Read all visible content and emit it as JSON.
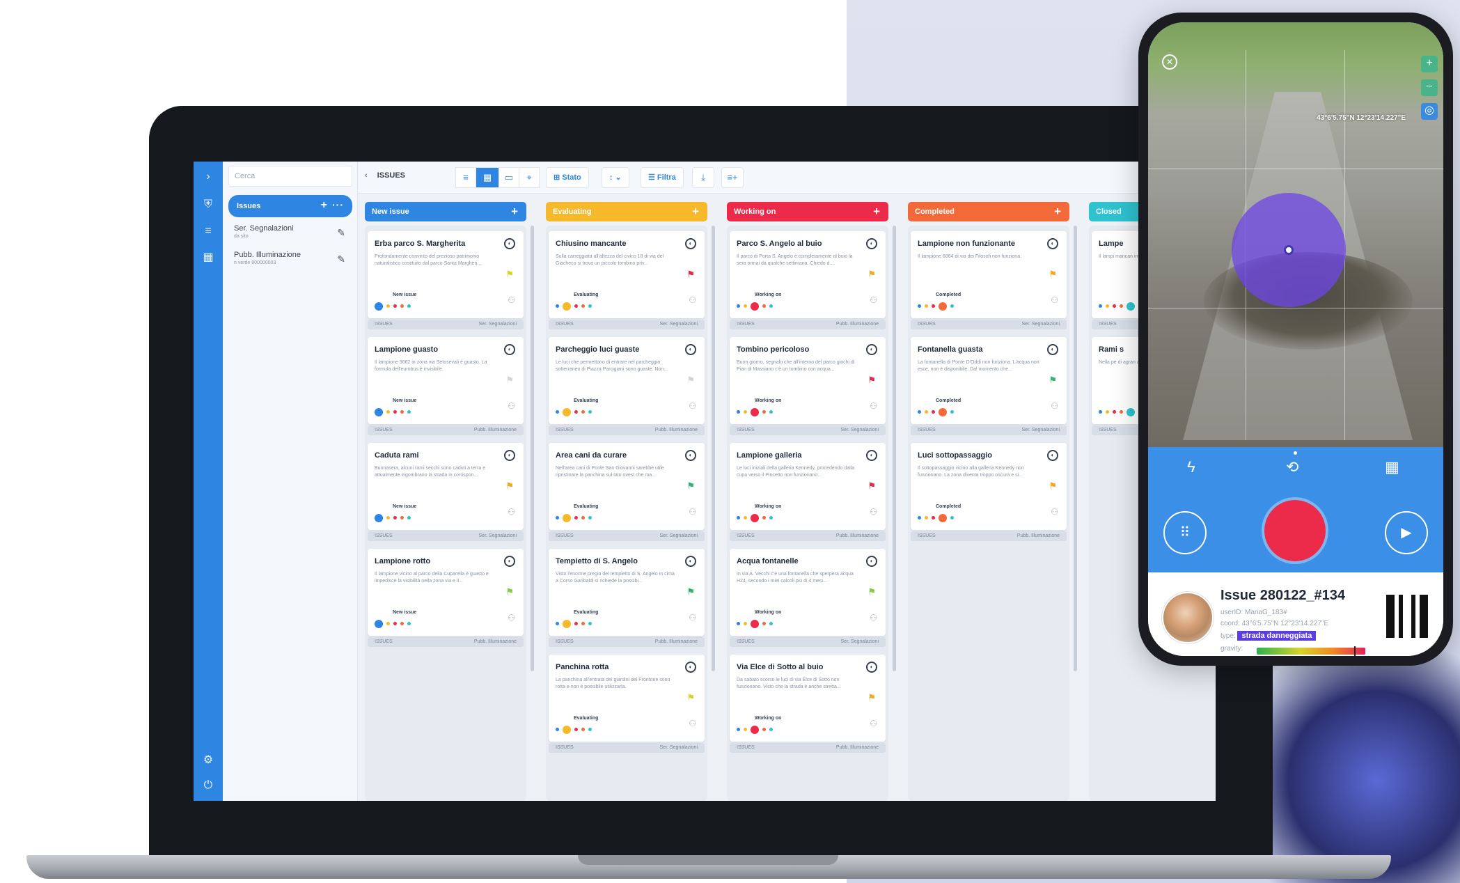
{
  "app": {
    "search_placeholder": "Cerca",
    "issues_label": "Issues",
    "sidebar_items": [
      {
        "label": "Ser. Segnalazioni",
        "sub": "da sito"
      },
      {
        "label": "Pubb. Illuminazione",
        "sub": "n verde 800000003"
      }
    ],
    "breadcrumb": "ISSUES",
    "toolbar": {
      "stato_label": "Stato",
      "filtra_label": "Filtra"
    }
  },
  "columns": [
    {
      "title": "New issue",
      "color": "#2f86e2",
      "status_color": "#2f86e2",
      "cards": [
        {
          "title": "Erba parco S. Margherita",
          "desc": "Profondamente convinto del prezioso patrimonio naturalistico costituito dal parco Santa Margheri...",
          "status": "New issue",
          "flag": "#d6d42a",
          "foot_l": "ISSUES",
          "foot_r": "Ser. Segnalazioni"
        },
        {
          "title": "Lampione guasto",
          "desc": "Il lampione 3662 in zona via Setosevali è guasto. La formula dell'eurobus è invisibile.",
          "status": "New issue",
          "flag": "#d0d5dc",
          "foot_l": "ISSUES",
          "foot_r": "Pubb. Illuminazione"
        },
        {
          "title": "Caduta rami",
          "desc": "Buonasera, alcuni rami secchi sono caduti a terra e attualmente ingombrano la strada in corrispon...",
          "status": "New issue",
          "flag": "#f3a623",
          "foot_l": "ISSUES",
          "foot_r": "Ser. Segnalazioni"
        },
        {
          "title": "Lampione rotto",
          "desc": "Il lampione vicino al parco della Cuparella è guasto e impedisce la visibilità nella zona via e il...",
          "status": "New issue",
          "flag": "#7fce3e",
          "foot_l": "ISSUES",
          "foot_r": "Pubb. Illuminazione"
        }
      ]
    },
    {
      "title": "Evaluating",
      "color": "#f5b92b",
      "status_color": "#f5b92b",
      "cards": [
        {
          "title": "Chiusino mancante",
          "desc": "Sulla carreggiata all'altezza del civico 18 di via del Giacheco si trova un piccolo tombino priv...",
          "status": "Evaluating",
          "flag": "#e8294a",
          "foot_l": "ISSUES",
          "foot_r": "Ser. Segnalazioni"
        },
        {
          "title": "Parcheggio luci guaste",
          "desc": "Le luci che permettono di entrare nel parcheggio sotterraneo di Piazza Parcigiani sono guaste. Non...",
          "status": "Evaluating",
          "flag": "#d0d5dc",
          "foot_l": "ISSUES",
          "foot_r": "Pubb. Illuminazione"
        },
        {
          "title": "Area cani da curare",
          "desc": "Nell'area cani di Ponte San Giovanni sarebbe utile ripristinare la panchina sul lato ovest che ma...",
          "status": "Evaluating",
          "flag": "#2fb56a",
          "foot_l": "ISSUES",
          "foot_r": "Ser. Segnalazioni"
        },
        {
          "title": "Tempietto di S. Angelo",
          "desc": "Visto l'enorme pregio del tempietto di S. Angelo in cima a Corso Garibaldi si richiede la possibi...",
          "status": "Evaluating",
          "flag": "#2fb56a",
          "foot_l": "ISSUES",
          "foot_r": "Pubb. Illuminazione"
        },
        {
          "title": "Panchina rotta",
          "desc": "La panchina all'entrata dei giardini del Frontone sono rotta e non è possibile utilizzarla.",
          "status": "Evaluating",
          "flag": "#d6d42a",
          "foot_l": "ISSUES",
          "foot_r": "Ser. Segnalazioni"
        }
      ]
    },
    {
      "title": "Working on",
      "color": "#ec2a4a",
      "status_color": "#ec2a4a",
      "cards": [
        {
          "title": "Parco S. Angelo al buio",
          "desc": "Il parco di Porta S. Angelo è completamente al buio la sera ormai da qualche settimana. Chiedo d...",
          "status": "Working on",
          "flag": "#f3a623",
          "foot_l": "ISSUES",
          "foot_r": "Pubb. Illuminazione"
        },
        {
          "title": "Tombino pericoloso",
          "desc": "Buon giorno, segnalo che all'interno del parco giochi di Pian di Massiano c'è un tombino con acqua...",
          "status": "Working on",
          "flag": "#e8294a",
          "foot_l": "ISSUES",
          "foot_r": "Ser. Segnalazioni"
        },
        {
          "title": "Lampione galleria",
          "desc": "Le luci iniziali della galleria Kennedy, procedendo dalla cupa verso il Pincetto non funzionano...",
          "status": "Working on",
          "flag": "#e8294a",
          "foot_l": "ISSUES",
          "foot_r": "Pubb. Illuminazione"
        },
        {
          "title": "Acqua fontanelle",
          "desc": "In via A. Vecchi c'è una fontanella che sperpera acqua H24, secondo i miei calcoli più di 4 mesi...",
          "status": "Working on",
          "flag": "#7fce3e",
          "foot_l": "ISSUES",
          "foot_r": "Ser. Segnalazioni"
        },
        {
          "title": "Via Elce di Sotto al buio",
          "desc": "Da sabato scorso le luci di via Elce di Sotto non funzionano. Visto che la strada è anche stretta...",
          "status": "Working on",
          "flag": "#f3a623",
          "foot_l": "ISSUES",
          "foot_r": "Pubb. Illuminazione"
        }
      ]
    },
    {
      "title": "Completed",
      "color": "#f26a3a",
      "status_color": "#f26a3a",
      "cards": [
        {
          "title": "Lampione non funzionante",
          "desc": "Il lampione 6864 di via dei Filosofi non funziona.",
          "status": "Completed",
          "flag": "#f3a623",
          "foot_l": "ISSUES",
          "foot_r": "Ser. Segnalazioni"
        },
        {
          "title": "Fontanella guasta",
          "desc": "La fontanella di Ponte D'Oddi non funziona. L'acqua non esce, non è disponibile. Dal momento che...",
          "status": "Completed",
          "flag": "#2fb56a",
          "foot_l": "ISSUES",
          "foot_r": "Ser. Segnalazioni"
        },
        {
          "title": "Luci sottopassaggio",
          "desc": "Il sottopassaggio vicino alla galleria Kennedy non funzionano. La zona diventa troppo oscura e si...",
          "status": "Completed",
          "flag": "#f3a623",
          "foot_l": "ISSUES",
          "foot_r": "Pubb. Illuminazione"
        }
      ]
    },
    {
      "title": "Closed",
      "color": "#2ec3cf",
      "status_color": "#2ec3cf",
      "cards": [
        {
          "title": "Lampe",
          "desc": "Il lampi mancan invers...",
          "status": "",
          "flag": "#d0d5dc",
          "foot_l": "ISSUES",
          "foot_r": ""
        },
        {
          "title": "Rami s",
          "desc": "Nella pe di agran alcuni...",
          "status": "",
          "flag": "#d0d5dc",
          "foot_l": "ISSUES",
          "foot_r": ""
        }
      ]
    }
  ],
  "phone": {
    "coords_overlay": "43°6'5.75\"N 12°23'14.227\"E",
    "issue_title": "Issue 280122_#134",
    "userid_label": "userID:",
    "userid": "MariaG_183#",
    "coord_label": "coord:",
    "coord": "43°6'5.75\"N 12°23'14.227\"E",
    "type_label": "type:",
    "type": "strada danneggiata",
    "gravity_label": "gravity:",
    "gravity_level": 0.9
  }
}
